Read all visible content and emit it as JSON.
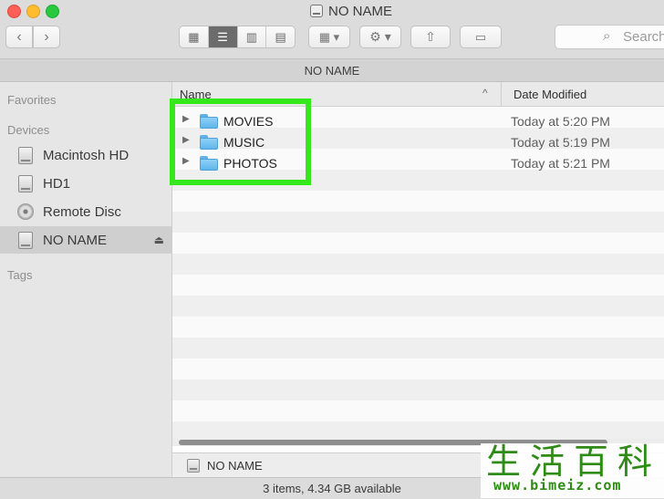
{
  "window": {
    "title": "NO NAME"
  },
  "toolbar": {
    "back_icon": "chevron-left-icon",
    "forward_icon": "chevron-right-icon",
    "view_modes": [
      "icon-view",
      "list-view",
      "column-view",
      "cover-flow-view"
    ],
    "active_view": "list-view",
    "search_placeholder": "Search"
  },
  "path_bar": {
    "label": "NO NAME"
  },
  "sidebar": {
    "sections": {
      "favorites": "Favorites",
      "devices": "Devices",
      "tags": "Tags"
    },
    "devices": [
      {
        "label": "Macintosh HD",
        "icon": "hard-drive-icon"
      },
      {
        "label": "HD1",
        "icon": "hard-drive-icon"
      },
      {
        "label": "Remote Disc",
        "icon": "disc-icon"
      },
      {
        "label": "NO NAME",
        "icon": "hard-drive-icon",
        "selected": true,
        "eject": "⏏"
      }
    ]
  },
  "columns": {
    "name": "Name",
    "date_modified": "Date Modified"
  },
  "files": [
    {
      "name": "MOVIES",
      "date": "Today at 5:20 PM"
    },
    {
      "name": "MUSIC",
      "date": "Today at 5:19 PM"
    },
    {
      "name": "PHOTOS",
      "date": "Today at 5:21 PM"
    }
  ],
  "bottom_path": {
    "label": "NO NAME"
  },
  "status": {
    "text": "3 items, 4.34 GB available"
  },
  "watermark": {
    "chinese": "生活百科",
    "url": "www.bimeiz.com"
  },
  "colors": {
    "highlight": "#34e81b",
    "folder": "#6cc0f0"
  }
}
